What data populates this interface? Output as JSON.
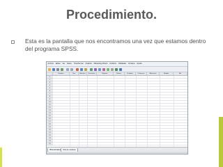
{
  "slide": {
    "title": "Procedimiento.",
    "bullet": "Esta es la pantalla que nos encontramos una vez que estamos dentro del programa SPSS."
  },
  "spss": {
    "menu": [
      "Archivo",
      "Editar",
      "Ver",
      "Datos",
      "Transformar",
      "Analizar",
      "Marketing directo",
      "Gráficos",
      "Utilidades",
      "Ventana",
      "Ayuda"
    ],
    "columns": [
      "Nombre",
      "Tipo",
      "Anchura",
      "Decimales",
      "Etiqueta",
      "Valores",
      "Perdidos",
      "Columnas",
      "Alineación",
      "Medida",
      "Rol"
    ],
    "rows": [
      "1",
      "2",
      "3",
      "4",
      "5",
      "6",
      "7",
      "8",
      "9",
      "10",
      "11",
      "12",
      "13",
      "14",
      "15",
      "16",
      "17",
      "18",
      "19",
      "20",
      "21",
      "22",
      "23",
      "24",
      "25"
    ],
    "tabs": {
      "data_view": "Vista de datos",
      "variable_view": "Vista de variables"
    }
  },
  "colors": {
    "title": "#595959",
    "accent_bar": "#b6c93a",
    "accent_bar_light": "#d4e24c"
  }
}
